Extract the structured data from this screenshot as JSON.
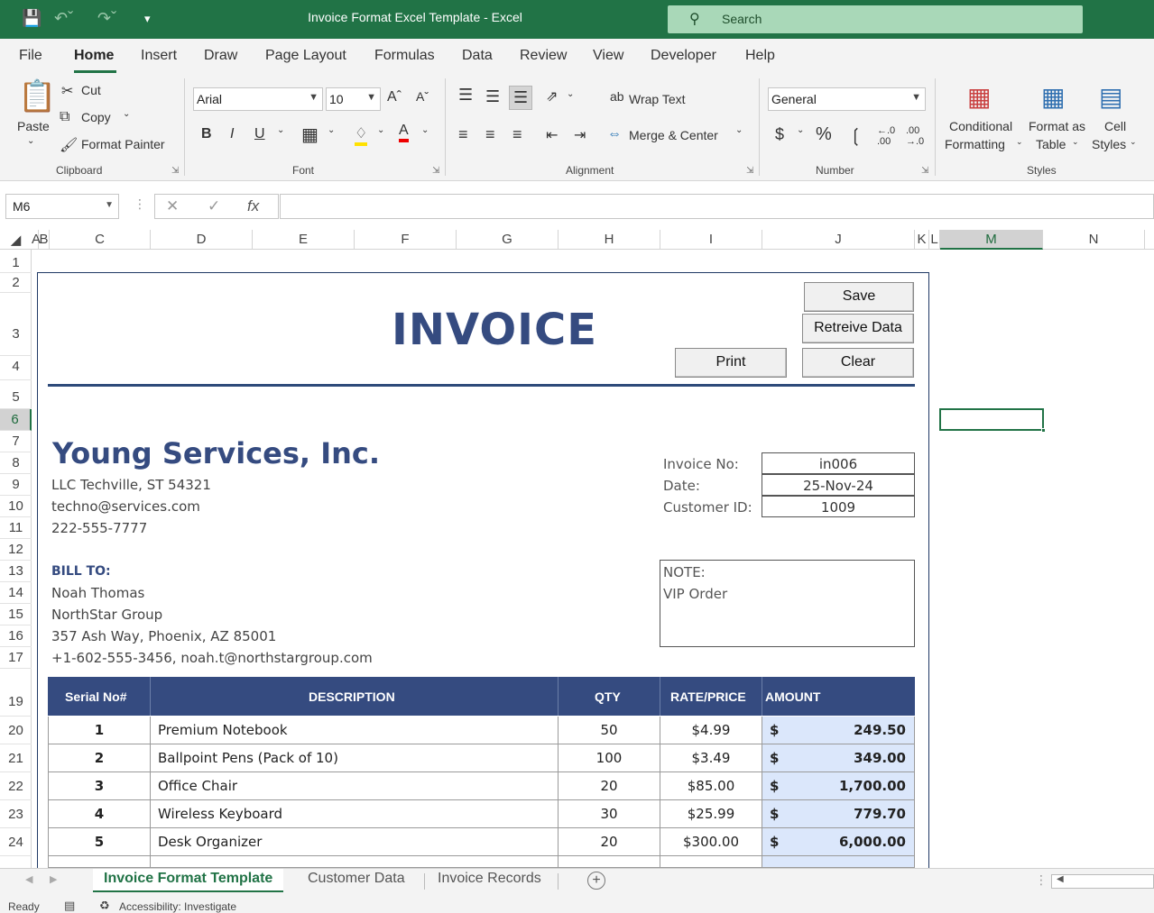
{
  "app": {
    "window_title": "Invoice Format Excel Template  -  Excel",
    "search_placeholder": "Search"
  },
  "menu": [
    "File",
    "Home",
    "Insert",
    "Draw",
    "Page Layout",
    "Formulas",
    "Data",
    "Review",
    "View",
    "Developer",
    "Help"
  ],
  "ribbon": {
    "clipboard": {
      "paste": "Paste",
      "cut": "Cut",
      "copy": "Copy",
      "format_painter": "Format Painter",
      "label": "Clipboard"
    },
    "font": {
      "name": "Arial",
      "size": "10",
      "label": "Font"
    },
    "alignment": {
      "wrap": "Wrap Text",
      "merge": "Merge & Center",
      "label": "Alignment"
    },
    "number": {
      "format": "General",
      "label": "Number"
    },
    "styles": {
      "cond1": "Conditional",
      "cond2": "Formatting",
      "fmt1": "Format as",
      "fmt2": "Table",
      "cell1": "Cell",
      "cell2": "Styles",
      "label": "Styles"
    }
  },
  "formula_bar": {
    "name_box": "M6",
    "formula": ""
  },
  "columns": [
    "A",
    "B",
    "C",
    "D",
    "E",
    "F",
    "G",
    "H",
    "I",
    "J",
    "K",
    "L",
    "M",
    "N"
  ],
  "rows": [
    "1",
    "2",
    "3",
    "4",
    "5",
    "6",
    "7",
    "8",
    "9",
    "10",
    "11",
    "12",
    "13",
    "14",
    "15",
    "16",
    "17",
    "19",
    "20",
    "21",
    "22",
    "23",
    "24"
  ],
  "invoice": {
    "title": "INVOICE",
    "buttons": {
      "save": "Save",
      "retrieve": "Retreive Data",
      "print": "Print",
      "clear": "Clear"
    },
    "company": {
      "name": "Young Services, Inc.",
      "address": "LLC Techville, ST 54321",
      "email": "techno@services.com",
      "phone": "222-555-7777"
    },
    "meta": {
      "invoice_no_label": "Invoice No:",
      "invoice_no": "in006",
      "date_label": "Date:",
      "date": "25-Nov-24",
      "customer_id_label": "Customer ID:",
      "customer_id": "1009"
    },
    "bill_to": {
      "label": "BILL TO:",
      "name": "Noah Thomas",
      "company": "NorthStar Group",
      "address": "357 Ash Way, Phoenix, AZ 85001",
      "contact": "+1-602-555-3456, noah.t@northstargroup.com"
    },
    "note": {
      "label": "NOTE:",
      "text": "VIP Order"
    },
    "table": {
      "headers": {
        "serial": "Serial No#",
        "desc": "DESCRIPTION",
        "qty": "QTY",
        "rate": "RATE/PRICE",
        "amount": "AMOUNT"
      },
      "currency": "$",
      "items": [
        {
          "serial": "1",
          "desc": "Premium Notebook",
          "qty": "50",
          "rate": "$4.99",
          "amount": "249.50"
        },
        {
          "serial": "2",
          "desc": "Ballpoint Pens (Pack of 10)",
          "qty": "100",
          "rate": "$3.49",
          "amount": "349.00"
        },
        {
          "serial": "3",
          "desc": "Office Chair",
          "qty": "20",
          "rate": "$85.00",
          "amount": "1,700.00"
        },
        {
          "serial": "4",
          "desc": "Wireless Keyboard",
          "qty": "30",
          "rate": "$25.99",
          "amount": "779.70"
        },
        {
          "serial": "5",
          "desc": "Desk Organizer",
          "qty": "20",
          "rate": "$300.00",
          "amount": "6,000.00"
        }
      ]
    }
  },
  "sheets": [
    "Invoice Format Template",
    "Customer Data",
    "Invoice Records"
  ],
  "status": {
    "ready": "Ready",
    "accessibility": "Accessibility: Investigate"
  }
}
